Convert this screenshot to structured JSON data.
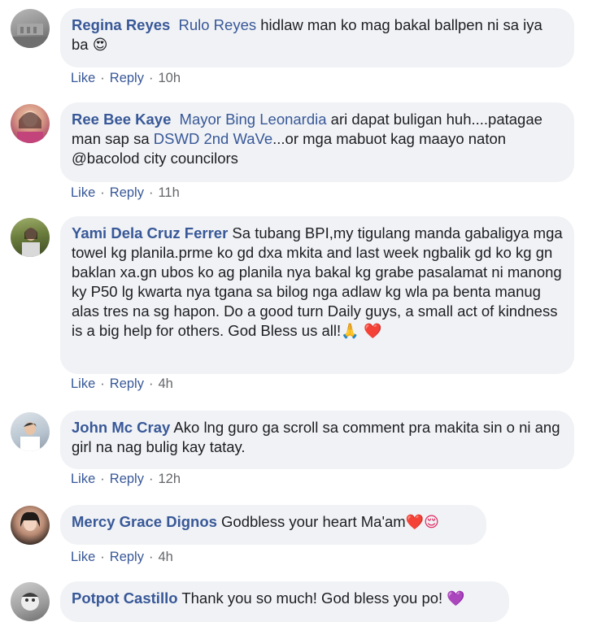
{
  "comments": [
    {
      "author": "Regina Reyes",
      "mention": "Rulo Reyes",
      "text": " hidlaw man ko mag bakal ballpen ni sa iya ba",
      "emoji": "😍",
      "like_label": "Like",
      "reply_label": "Reply",
      "time": "10h"
    },
    {
      "author": "Ree Bee Kaye",
      "mention": "Mayor Bing Leonardia",
      "text_1": " ari dapat buligan huh....patagae man sap sa ",
      "mention_2": "DSWD 2nd WaVe",
      "text_2": "...or mga mabuot kag maayo naton @bacolod city councilors",
      "like_label": "Like",
      "reply_label": "Reply",
      "time": "11h"
    },
    {
      "author": "Yami Dela Cruz Ferrer",
      "text": " Sa tubang BPI,my tigulang manda gabaligya mga towel kg planila.prme ko gd dxa mkita and last week ngbalik gd ko kg gn baklan xa.gn ubos ko ag planila nya bakal kg grabe pasalamat ni manong ky P50 lg kwarta nya tgana sa bilog nga adlaw kg wla pa benta manug alas tres na sg hapon. Do a good turn Daily guys, a small act of kindness is a big help for others. God Bless us all!",
      "emoji": "🙏 ❤️",
      "like_label": "Like",
      "reply_label": "Reply",
      "time": "4h"
    },
    {
      "author": "John Mc Cray",
      "text": " Ako lng guro ga scroll sa comment pra makita sin o ni ang girl na nag bulig kay tatay.",
      "like_label": "Like",
      "reply_label": "Reply",
      "time": "12h"
    },
    {
      "author": "Mercy Grace Dignos",
      "text": " Godbless your heart Ma'am",
      "emoji": "❤️😌",
      "like_label": "Like",
      "reply_label": "Reply",
      "time": "4h"
    },
    {
      "author": "Potpot Castillo",
      "text": " Thank you so much! God bless you po! ",
      "emoji": "💜"
    }
  ],
  "colors": {
    "bubble": "#f0f2f5",
    "name": "#385898",
    "text": "#1c1e21",
    "time": "#65676b"
  }
}
